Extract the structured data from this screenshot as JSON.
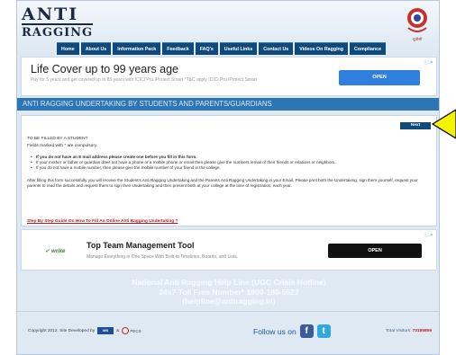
{
  "logo": {
    "line1": "ANTI",
    "line2": "RAGGING"
  },
  "emblem": {
    "caption": "यूजीसी"
  },
  "nav": {
    "items": [
      "Home",
      "About Us",
      "Information Pack",
      "Feedback",
      "FAQ's",
      "Useful Links",
      "Contact Us",
      "Videos On Ragging",
      "Compliance"
    ]
  },
  "ad1": {
    "title": "Life Cover up to 99 years age",
    "subtitle": "Pay for 5 years and get covered up to 85 years with ICICI Pru iProtect Smart *T&C apply ICICI Pru iProtect Smart",
    "button": "OPEN",
    "mark": "ⓘ ✕"
  },
  "section": {
    "title": "ANTI RAGGING UNDERTAKING BY STUDENTS AND PARENTS/GUARDIANS"
  },
  "content": {
    "next": "Next",
    "heading": "TO BE FILLED BY A STUDENT",
    "required_note": "Fields marked with * are compulsory.",
    "bullets": [
      "If you do not have an E mail address please create one before you fill in this form.",
      "If your mother or father or guardian does not have a phone or a mobile phone or email then please give the numbers /email of their friends or relations or neighbors.",
      "If you do not have a mobile number, then please give the mobile number of your friend in the college."
    ],
    "paragraph": "After filling this form successfully you will receive the Student's Anti Ragging Undertaking and the Parents Anti Ragging Undertaking in your Email. Please print both the Undertaking, sign them yourself, request your parents to read the details and request them to sign their Undertaking and then present both at your college at the time of registration, each year.",
    "guide_link": "Step By Step Guide On How To Fill An Online Anti Ragging Undertaking ?"
  },
  "ad2": {
    "brand": "wrike",
    "title": "Top Team Management Tool",
    "subtitle": "Manage Everything in One Space With Built-in Timelines, Boards, and Lists.",
    "button": "OPEN",
    "mark": "ⓘ ✕"
  },
  "helpline": {
    "line1": "National Anti Ragging Help Line (UGC Crisis Hotline)",
    "line2": "24x7 Toll Free Number* 1800-180-5522",
    "line3": "(helpline@antiragging.in)"
  },
  "footer": {
    "copyright": "Copyright 2012. Site Developed by",
    "ms_logo": "MS",
    "amp": "&",
    "pecs": "PECS",
    "follow": "Follow us on",
    "visitors_label": "Total Visitors:",
    "visitors_count": "73185859"
  },
  "colors": {
    "nav_bg": "#0f4a7d",
    "section_bar": "#2d76b5",
    "page_bg": "#dfe9f3",
    "arrow": "#f4f400"
  }
}
